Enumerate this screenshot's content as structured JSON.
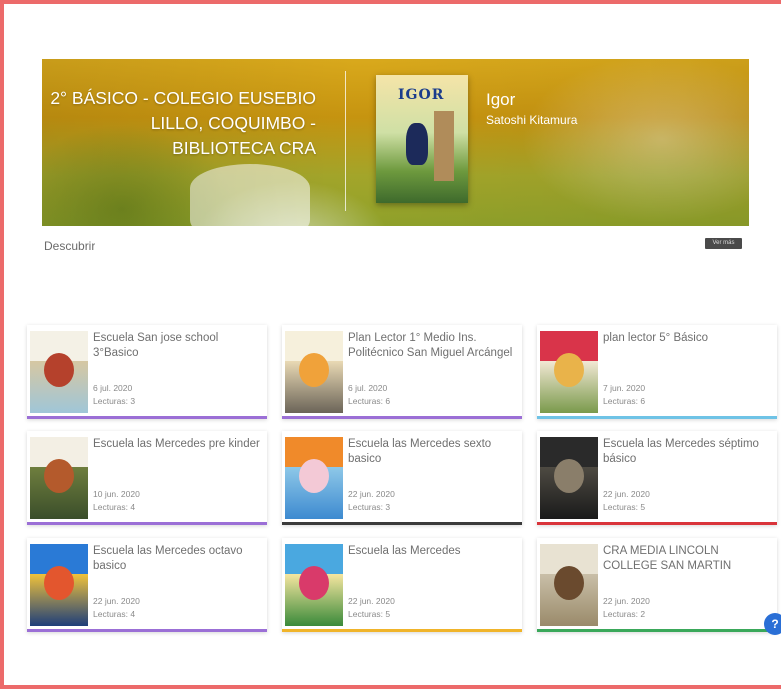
{
  "banner": {
    "title": "2° BÁSICO - COLEGIO EUSEBIO LILLO, COQUIMBO - BIBLIOTECA CRA",
    "featured_book": {
      "title": "Igor",
      "author": "Satoshi Kitamura",
      "cover_text": "IGOR"
    }
  },
  "section": {
    "label": "Descubrir",
    "see_more": "Ver más"
  },
  "help_icon": "help-icon",
  "cards": [
    {
      "title": "Escuela San jose school 3°Basico",
      "date": "6 jul. 2020",
      "reads": "Lecturas: 3",
      "accent": "#9b6fd6",
      "cover": [
        "#f4f1e6",
        "#d6c7a2",
        "#b5412c",
        "#9fc6d8"
      ]
    },
    {
      "title": "Plan Lector 1° Medio Ins. Politécnico San Miguel Arcángel",
      "date": "6 jul. 2020",
      "reads": "Lecturas: 6",
      "accent": "#9b6fd6",
      "cover": [
        "#f6f0dc",
        "#e9d9b4",
        "#f0a23a",
        "#6b6458"
      ]
    },
    {
      "title": "plan lector 5° Básico",
      "date": "7 jun. 2020",
      "reads": "Lecturas: 6",
      "accent": "#6fc3e6",
      "cover": [
        "#d9344a",
        "#f2e8d4",
        "#e9b34a",
        "#7a9a4c"
      ]
    },
    {
      "title": "Escuela las Mercedes pre kinder",
      "date": "10 jun. 2020",
      "reads": "Lecturas: 4",
      "accent": "#9b6fd6",
      "cover": [
        "#f3efe4",
        "#6f7e3e",
        "#b45a2c",
        "#3a4e2a"
      ]
    },
    {
      "title": "Escuela las Mercedes sexto basico",
      "date": "22 jun. 2020",
      "reads": "Lecturas: 3",
      "accent": "#3a3a3a",
      "cover": [
        "#f08a2a",
        "#8ec8e8",
        "#f3c9d6",
        "#3d8ad0"
      ]
    },
    {
      "title": "Escuela las Mercedes séptimo básico",
      "date": "22 jun. 2020",
      "reads": "Lecturas: 5",
      "accent": "#d9343a",
      "cover": [
        "#2a2a2a",
        "#4e4a42",
        "#8a7e6a",
        "#1a1a1a"
      ]
    },
    {
      "title": "Escuela las Mercedes octavo basico",
      "date": "22 jun. 2020",
      "reads": "Lecturas: 4",
      "accent": "#9b6fd6",
      "cover": [
        "#2a7ad6",
        "#f0c23a",
        "#e3562e",
        "#1e3e7a"
      ]
    },
    {
      "title": "Escuela las Mercedes",
      "date": "22 jun. 2020",
      "reads": "Lecturas: 5",
      "accent": "#f0b42a",
      "cover": [
        "#4aa8e0",
        "#f6e6a0",
        "#d93a6a",
        "#3a8a3a"
      ]
    },
    {
      "title": "CRA MEDIA LINCOLN COLLEGE SAN MARTIN",
      "date": "22 jun. 2020",
      "reads": "Lecturas: 2",
      "accent": "#3aa85a",
      "cover": [
        "#e8e2d2",
        "#c9bfa8",
        "#6a4a2e",
        "#9a8a6a"
      ]
    }
  ]
}
